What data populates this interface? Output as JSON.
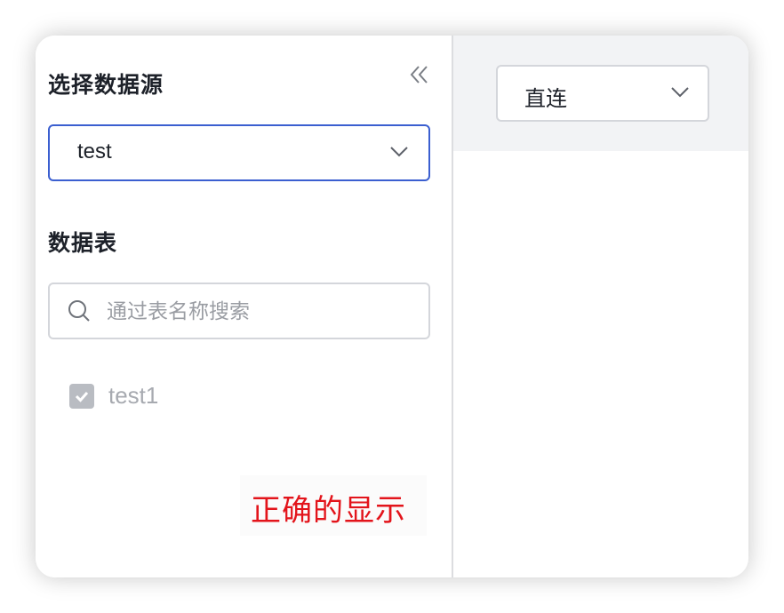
{
  "left_panel": {
    "datasource_title": "选择数据源",
    "datasource_select": {
      "value": "test"
    },
    "table_title": "数据表",
    "search": {
      "placeholder": "通过表名称搜索",
      "value": ""
    },
    "tables": [
      {
        "label": "test1",
        "checked": true,
        "disabled": true
      }
    ]
  },
  "right_panel": {
    "mode_select": {
      "value": "直连"
    }
  },
  "annotation": {
    "text": "正确的显示",
    "color": "#e3141b"
  },
  "colors": {
    "accent_border": "#3b5fd0",
    "panel_bg": "#f2f3f5",
    "checkbox_disabled": "#b9bcc2"
  },
  "icons": {
    "collapse": "double-chevron-left-icon",
    "dropdown": "chevron-down-icon",
    "search": "search-icon",
    "check": "check-icon"
  }
}
